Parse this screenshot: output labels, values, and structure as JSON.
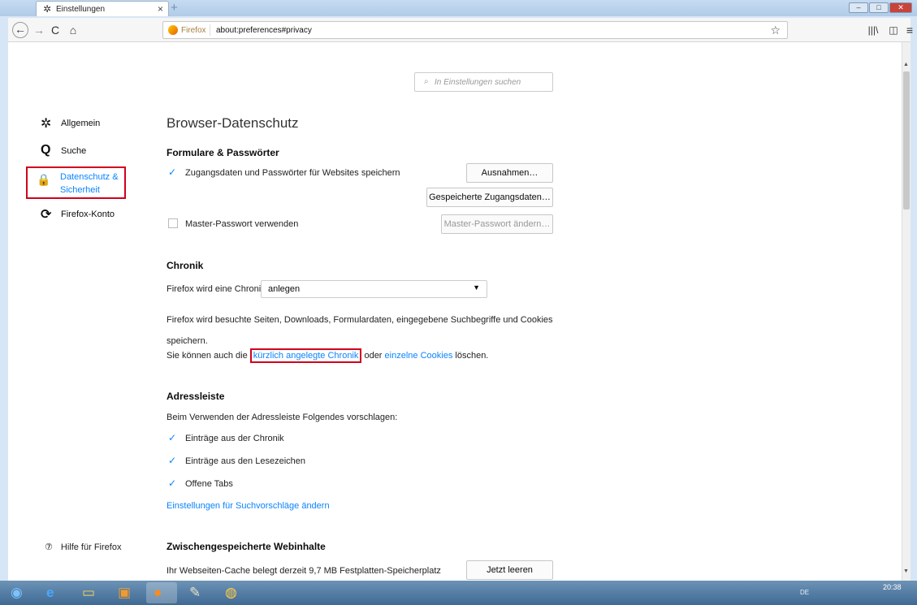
{
  "tab": {
    "icon": "gear-icon",
    "title": "Einstellungen",
    "close": "×",
    "new_tab": "+"
  },
  "window_controls": {
    "minimize": "–",
    "maximize": "□",
    "close": "✕"
  },
  "toolbar": {
    "back": "←",
    "forward": "→",
    "reload": "C",
    "home": "⌂",
    "library": "|||\\",
    "sidebar": "◫",
    "menu": "≡"
  },
  "urlbar": {
    "identity": "Firefox",
    "url": "about:preferences#privacy",
    "bookmark": "☆"
  },
  "search": {
    "placeholder": "In Einstellungen suchen",
    "icon": "⌕"
  },
  "categories": [
    {
      "label": "Allgemein",
      "icon": "gear-icon"
    },
    {
      "label": "Suche",
      "icon": "search-icon"
    },
    {
      "label": "Datenschutz & Sicherheit",
      "icon": "lock-icon",
      "selected": true
    },
    {
      "label": "Firefox-Konto",
      "icon": "sync-icon"
    }
  ],
  "help": {
    "label": "Hilfe für Firefox",
    "icon": "help-icon"
  },
  "main": {
    "title": "Browser-Datenschutz",
    "forms": {
      "heading": "Formulare & Passwörter",
      "save_logins": {
        "label": "Zugangsdaten und Passwörter für Websites speichern",
        "checked": true
      },
      "exceptions_button": "Ausnahmen…",
      "saved_logins_button": "Gespeicherte Zugangsdaten…",
      "master_password": {
        "label": "Master-Passwort verwenden",
        "checked": false
      },
      "change_master_button": "Master-Passwort ändern…"
    },
    "history": {
      "heading": "Chronik",
      "mode_label": "Firefox wird eine Chronik",
      "mode_value": "anlegen",
      "description": "Firefox wird besuchte Seiten, Downloads, Formulardaten, eingegebene Suchbegriffe und Cookies speichern.",
      "clear_prefix": "Sie können auch die",
      "clear_recent_link": "kürzlich angelegte Chronik",
      "clear_middle": "oder",
      "cookies_link": "einzelne Cookies",
      "clear_suffix": "löschen."
    },
    "addressbar": {
      "heading": "Adressleiste",
      "intro": "Beim Verwenden der Adressleiste Folgendes vorschlagen:",
      "options": [
        {
          "label": "Einträge aus der Chronik",
          "checked": true
        },
        {
          "label": "Einträge aus den Lesezeichen",
          "checked": true
        },
        {
          "label": "Offene Tabs",
          "checked": true
        }
      ],
      "suggestions_link": "Einstellungen für Suchvorschläge ändern"
    },
    "cache": {
      "heading": "Zwischengespeicherte Webinhalte",
      "status": "Ihr Webseiten-Cache belegt derzeit 9,7 MB Festplatten-Speicherplatz",
      "clear_button": "Jetzt leeren"
    }
  },
  "taskbar": {
    "items": [
      "windows-start-icon",
      "ie-icon",
      "explorer-icon",
      "media-player-icon",
      "firefox-icon",
      "paint-icon",
      "chrome-icon"
    ],
    "tray": "DE",
    "clock": "20:38"
  },
  "colors": {
    "accent": "#0a84ff",
    "highlight": "#d0021b",
    "taskbar": "#4f7aa3"
  }
}
